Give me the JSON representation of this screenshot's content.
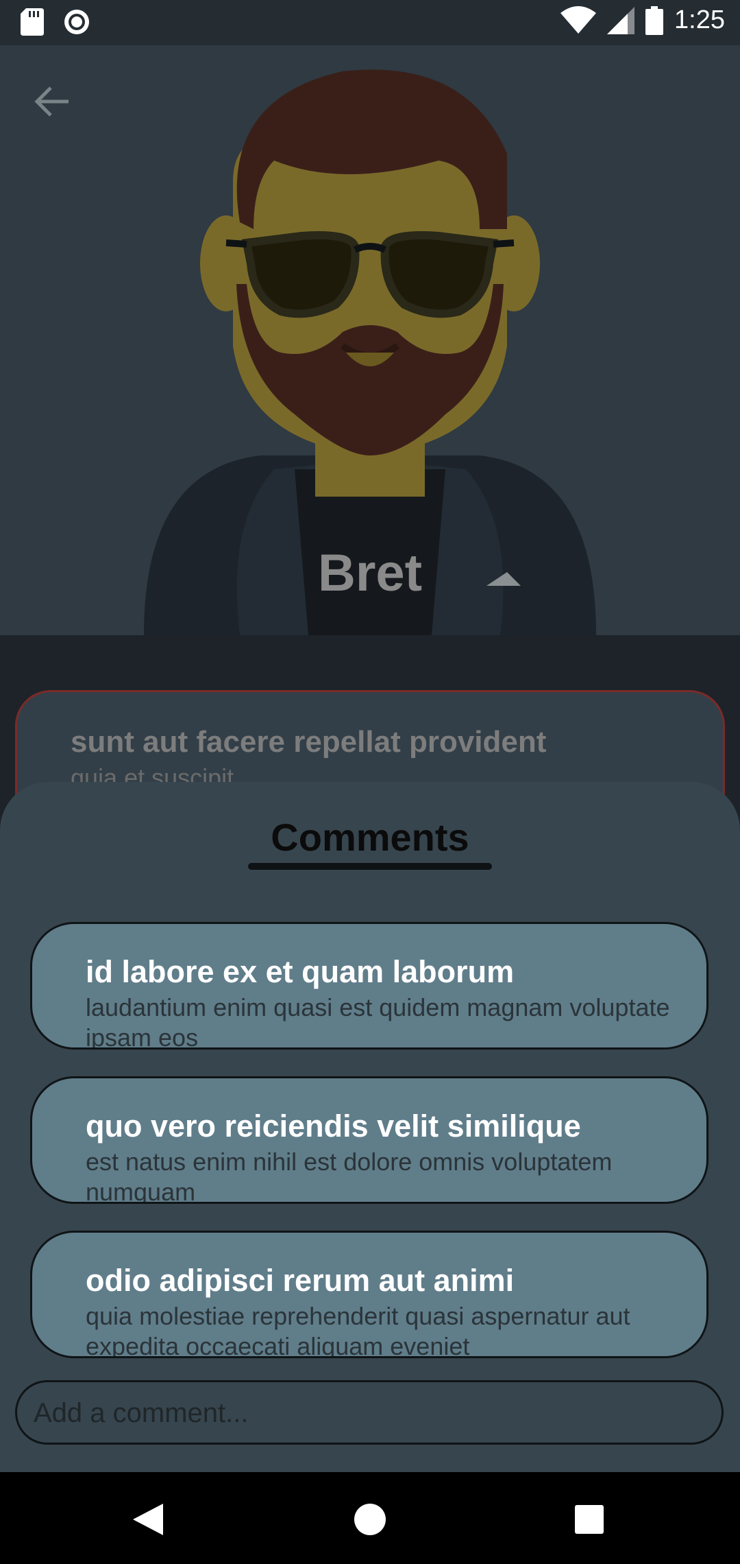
{
  "status_bar": {
    "time": "1:25",
    "icons": [
      "sd-card-icon",
      "record-icon",
      "wifi-icon",
      "signal-icon",
      "battery-icon"
    ]
  },
  "header": {
    "back_icon": "arrow-left-icon",
    "username": "Bret"
  },
  "post": {
    "title": "sunt aut facere repellat provident",
    "body": "quia et suscipit"
  },
  "comments_sheet": {
    "title": "Comments",
    "items": [
      {
        "title": "id labore ex et quam laborum",
        "body": "laudantium enim quasi est quidem magnam voluptate ipsam eos"
      },
      {
        "title": "quo vero reiciendis velit similique",
        "body": "est natus enim nihil est dolore omnis voluptatem numquam"
      },
      {
        "title": "odio adipisci rerum aut animi",
        "body": "quia molestiae reprehenderit quasi aspernatur aut expedita occaecati aliquam eveniet"
      }
    ],
    "input_placeholder": "Add a comment..."
  },
  "nav_bar": {
    "buttons": [
      "back-triangle-icon",
      "home-circle-icon",
      "recents-square-icon"
    ]
  },
  "colors": {
    "header_bg": "#2f3a42",
    "sheet_bg": "#37454e",
    "card_bg": "#607d8a",
    "accent_border": "#7a2a2a"
  }
}
